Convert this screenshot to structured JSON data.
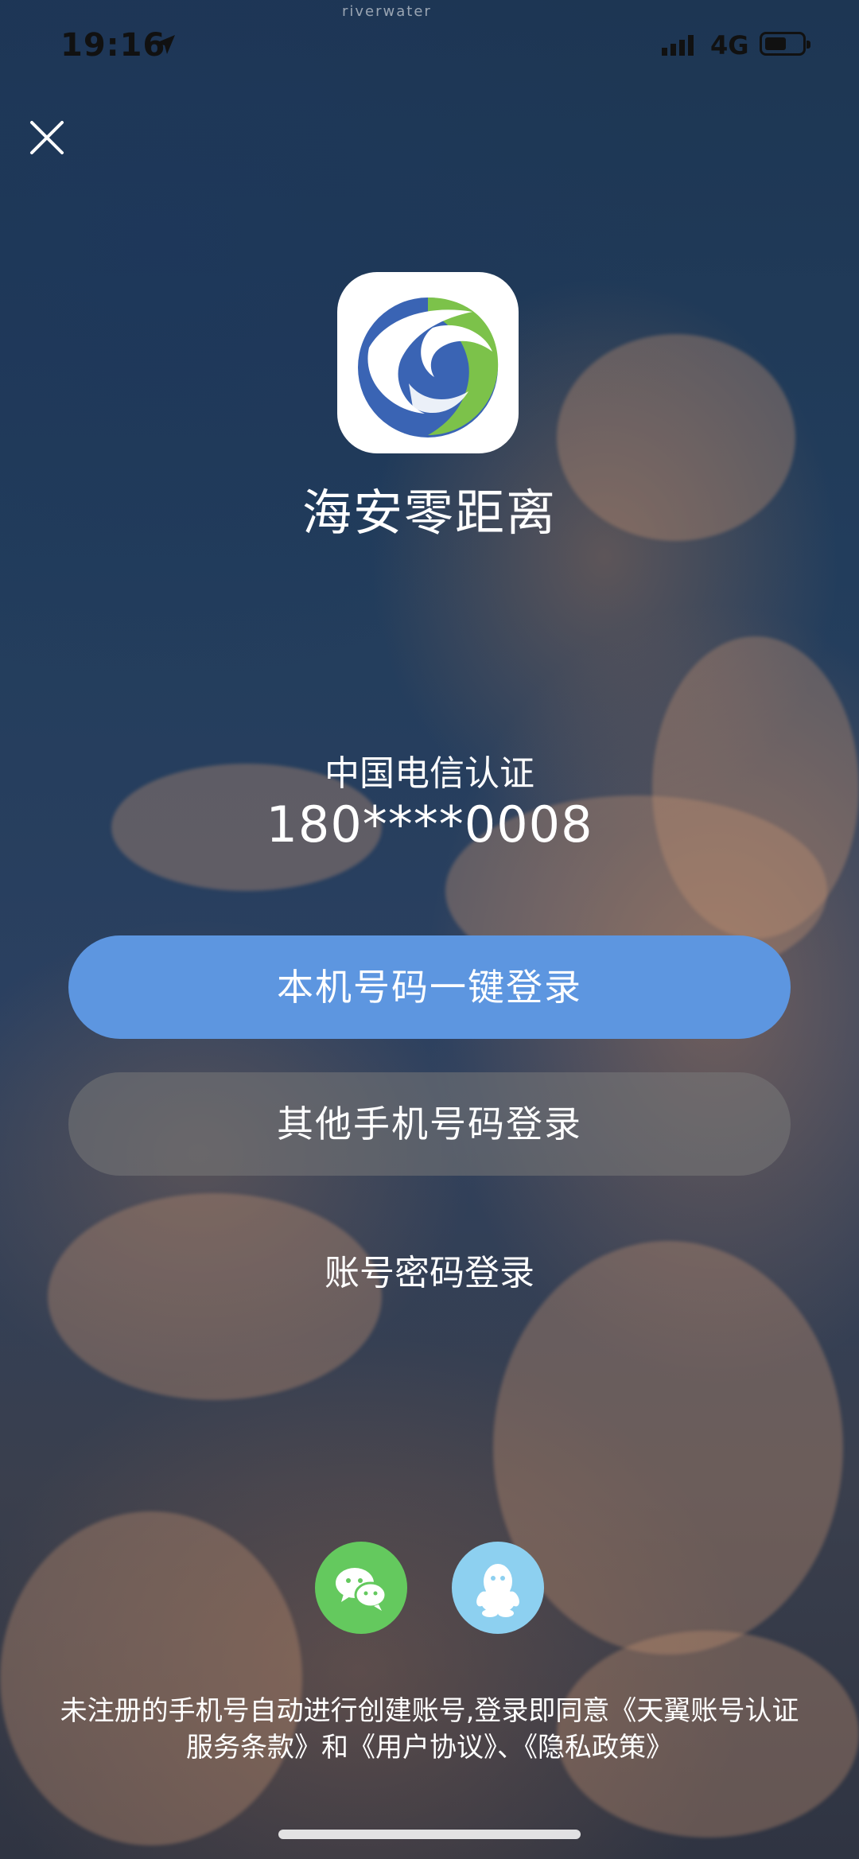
{
  "status_bar": {
    "time": "19:16",
    "network": "4G",
    "watermark": "riverwater"
  },
  "app": {
    "name": "海安零距离",
    "icon": "app-logo-icon"
  },
  "auth": {
    "carrier_label": "中国电信认证",
    "masked_phone": "180****0008"
  },
  "buttons": {
    "one_click_login": "本机号码一键登录",
    "other_phone_login": "其他手机号码登录",
    "account_password_login": "账号密码登录"
  },
  "social": {
    "wechat_icon": "wechat-icon",
    "qq_icon": "qq-icon"
  },
  "terms": {
    "text": "未注册的手机号自动进行创建账号,登录即同意《天翼账号认证服务条款》和《用户协议》、《隐私政策》"
  },
  "colors": {
    "primary_button": "#5d96e0",
    "wechat": "#64c95e",
    "qq": "#8dd0f0"
  }
}
